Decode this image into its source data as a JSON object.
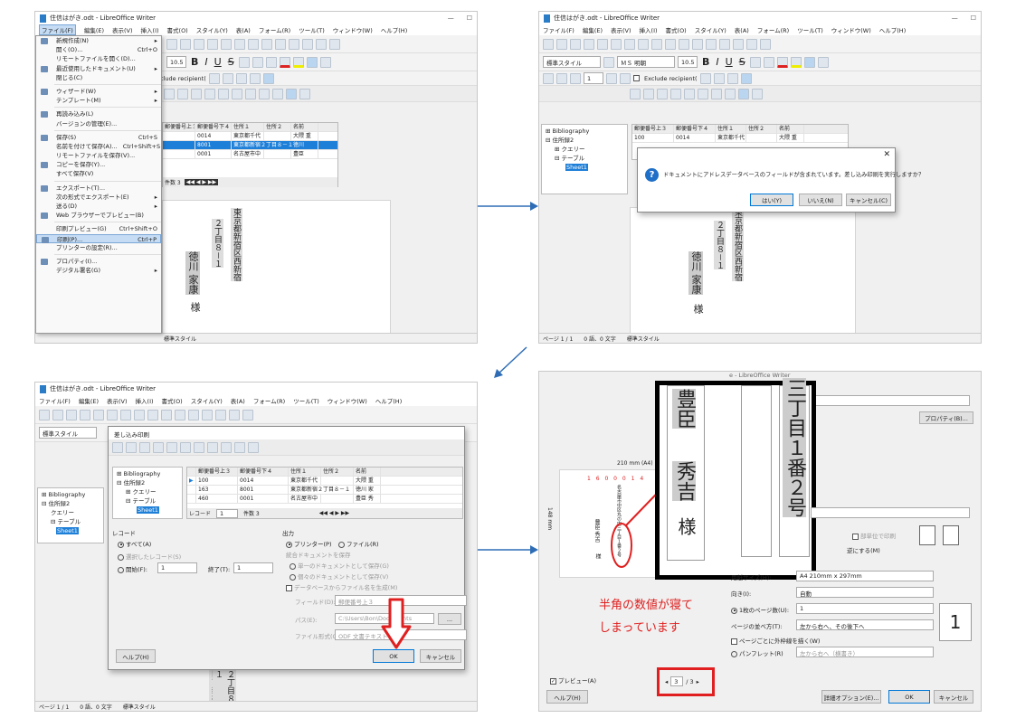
{
  "window": {
    "title": "住信はがき.odt - LibreOffice Writer"
  },
  "menu": [
    "ファイル(F)",
    "編集(E)",
    "表示(V)",
    "挿入(I)",
    "書式(O)",
    "スタイル(Y)",
    "表(A)",
    "フォーム(R)",
    "ツール(T)",
    "ウィンドウ(W)",
    "ヘルプ(H)"
  ],
  "toolbar": {
    "style": "標準スタイル",
    "font": "ＭＳ 明朝",
    "size": "10.5",
    "record_no": "1",
    "exclude": "Exclude recipient(",
    "exclude_partial": "clude recipient("
  },
  "db_tree": [
    "Bibliography",
    "住所録2",
    "クエリー",
    "テーブル",
    "Sheet1"
  ],
  "grid": {
    "headers": [
      "郵便番号上３",
      "郵便番号下４",
      "住所１",
      "住所２",
      "名前"
    ],
    "rows": [
      [
        "100",
        "0014",
        "東京都千代",
        "",
        "大隈 重"
      ],
      [
        "163",
        "8001",
        "東京都新宿２丁目８－１",
        "",
        "徳川 家"
      ],
      [
        "460",
        "0001",
        "名古屋市中",
        "",
        "豊臣 秀"
      ]
    ],
    "rows_p1": [
      [
        "100",
        "0014",
        "東京都千代",
        "",
        "大隈 重"
      ],
      [
        "163",
        "8001",
        "東京都新宿２丁目８－１徳川",
        "",
        ""
      ],
      [
        "460",
        "0001",
        "名古屋市中",
        "",
        "豊臣"
      ]
    ],
    "record_label": "レコード",
    "record_total": "/ 3 (1)",
    "record_value": "1",
    "record_of": "件数 3"
  },
  "address_doc": {
    "line1": "東京都新宿区西新宿",
    "line2": "２丁目８－１",
    "name": "徳川 家康",
    "sama": "様"
  },
  "file_menu": [
    {
      "label": "新規作成(N)",
      "sc": "▸"
    },
    {
      "label": "開く(O)...",
      "sc": "Ctrl+O"
    },
    {
      "label": "リモートファイルを開く(D)...",
      "sc": ""
    },
    {
      "label": "最近使用したドキュメント(U)",
      "sc": "▸"
    },
    {
      "label": "閉じる(C)",
      "sc": ""
    },
    {
      "sep": true
    },
    {
      "label": "ウィザード(W)",
      "sc": "▸"
    },
    {
      "label": "テンプレート(M)",
      "sc": "▸"
    },
    {
      "sep": true
    },
    {
      "label": "再読み込み(L)",
      "sc": ""
    },
    {
      "label": "バージョンの管理(E)...",
      "sc": ""
    },
    {
      "sep": true
    },
    {
      "label": "保存(S)",
      "sc": "Ctrl+S"
    },
    {
      "label": "名前を付けて保存(A)...",
      "sc": "Ctrl+Shift+S"
    },
    {
      "label": "リモートファイルを保存(V)...",
      "sc": ""
    },
    {
      "label": "コピーを保存(Y)...",
      "sc": ""
    },
    {
      "label": "すべて保存(V)",
      "sc": ""
    },
    {
      "sep": true
    },
    {
      "label": "エクスポート(T)...",
      "sc": ""
    },
    {
      "label": "次の形式でエクスポート(E)",
      "sc": "▸"
    },
    {
      "label": "送る(D)",
      "sc": "▸"
    },
    {
      "label": "Web ブラウザーでプレビュー(B)",
      "sc": ""
    },
    {
      "sep": true
    },
    {
      "label": "印刷プレビュー(G)",
      "sc": "Ctrl+Shift+O"
    },
    {
      "label": "印刷(P)...",
      "sc": "Ctrl+P",
      "hl": true
    },
    {
      "label": "プリンターの設定(R)...",
      "sc": ""
    },
    {
      "sep": true
    },
    {
      "label": "プロパティ(I)...",
      "sc": ""
    },
    {
      "label": "デジタル署名(G)",
      "sc": "▸"
    }
  ],
  "confirm": {
    "message": "ドキュメントにアドレスデータベースのフィールドが含まれています。差し込み印刷を実行しますか？",
    "yes": "はい(Y)",
    "no": "いいえ(N)",
    "cancel": "キャンセル(C)"
  },
  "mailmerge": {
    "title": "差し込み印刷",
    "records_head": "レコード",
    "all": "すべて(A)",
    "selected": "選択したレコード(S)",
    "from": "開始(F):",
    "from_val": "1",
    "to": "終了(T):",
    "to_val": "1",
    "output_head": "出力",
    "printer": "プリンター(P)",
    "file": "ファイル(R)",
    "save_merged": "統合ドキュメントを保存",
    "single": "単一のドキュメントとして保存(G)",
    "indiv": "個々のドキュメントとして保存(V)",
    "gen_name": "データベースからファイル名を生成(M)",
    "field": "フィールド(D):",
    "field_val": "郵便番号上３",
    "path": "パス(E):",
    "path_val": "C:\\Users\\Bon\\Documents",
    "format": "ファイル形式(O):",
    "format_val": "ODF 文書テキスト",
    "help": "ヘルプ(H)",
    "ok": "OK",
    "cancel": "キャンセル"
  },
  "print": {
    "paper_size_label": "用紙サイズ(H):",
    "paper_size_val": "A4 210mm x 297mm",
    "orientation_label": "向き(I):",
    "orientation_val": "自動",
    "pages_per_sheet_label": "1枚のページ数(U):",
    "pages_per_sheet_val": "1",
    "order_label": "ページの並べ方(T):",
    "order_val": "左から右へ、その後下へ",
    "border_label": "ページごとに外枠線を描く(W)",
    "brochure_label": "パンフレット(R)",
    "brochure_val": "左から右へ（横書き）",
    "preview_label": "プレビュー(A)",
    "page_cur": "3",
    "page_total": "/ 3",
    "help": "ヘルプ(H)",
    "more": "詳細オプション(E)...",
    "ok": "OK",
    "cancel": "キャンセル",
    "properties": "プロパティ(B)...",
    "paper_dim_w": "210 mm (A4)",
    "paper_dim_h": "148 mm",
    "collate": "部単位で印刷",
    "reverse": "逆にする(M)",
    "big_number": "1",
    "title_fragment": "e - LibreOffice Writer"
  },
  "zoom": {
    "line1": "三丁目１番２号",
    "name1": "豊臣",
    "name2": "秀吉",
    "sama": "様"
  },
  "annotation": {
    "line1": "半角の数値が寝て",
    "line2": "しまっています",
    "color": "#e02020"
  },
  "preview_small": {
    "addr": "名古屋市中区丸の内三丁目１番２号",
    "name": "豊臣 秀吉",
    "sama": "様"
  },
  "statusbar": {
    "page": "ページ 1 / 1",
    "words": "0 語、0 文字",
    "style": "標準スタイル"
  }
}
